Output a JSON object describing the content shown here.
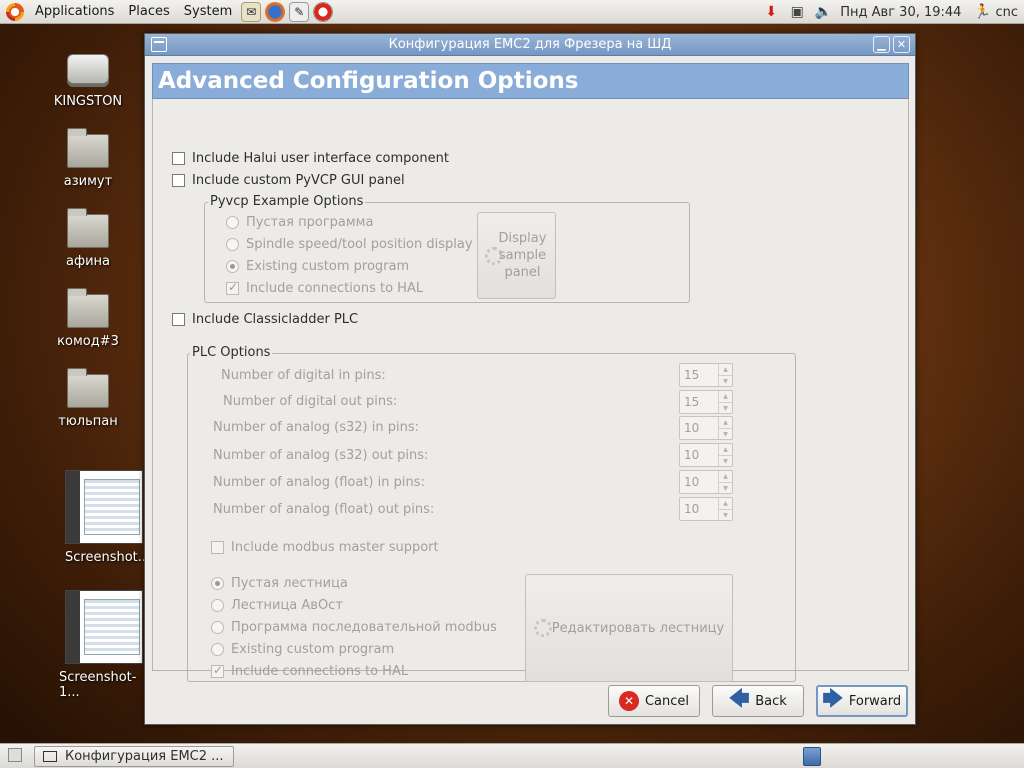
{
  "top_panel": {
    "menus": [
      "Applications",
      "Places",
      "System"
    ],
    "clock": "Пнд Авг 30, 19:44",
    "user": "cnc"
  },
  "desktop": {
    "icons": [
      "KINGSTON",
      "азимут",
      "афина",
      "комод#3",
      "тюльпан",
      "Screenshot...",
      "Screenshot-1..."
    ]
  },
  "window": {
    "title": "Конфигурация EMC2 для Фрезера на ШД",
    "heading": "Advanced Configuration Options",
    "options": {
      "halui": "Include Halui user interface component",
      "pyvcp": "Include custom PyVCP GUI panel",
      "classicladder": "Include Classicladder PLC"
    },
    "pyvcp_frame": {
      "title": "Pyvcp Example Options",
      "radios": [
        "Пустая программа",
        "Spindle speed/tool position display",
        "Existing custom program"
      ],
      "include_hal": "Include connections to HAL",
      "display_button": "Display sample panel"
    },
    "plc_frame": {
      "title": "PLC Options",
      "pins": [
        {
          "label": "Number of digital in pins:",
          "value": "15"
        },
        {
          "label": "Number of digital  out pins:",
          "value": "15"
        },
        {
          "label": "Number of analog (s32) in pins:",
          "value": "10"
        },
        {
          "label": "Number of analog (s32) out pins:",
          "value": "10"
        },
        {
          "label": "Number of analog (float) in pins:",
          "value": "10"
        },
        {
          "label": "Number of analog (float) out pins:",
          "value": "10"
        }
      ],
      "modbus": "Include modbus master support",
      "radios": [
        "Пустая лестница",
        "Лестница АвОст",
        "Программа последовательной modbus",
        "Existing custom program"
      ],
      "include_hal": "Include connections to HAL",
      "edit_button": "Редактировать лестницу"
    },
    "buttons": {
      "cancel": "Cancel",
      "back": "Back",
      "forward": "Forward"
    }
  },
  "bottom_panel": {
    "task": "Конфигурация EMC2 ..."
  },
  "colors": {
    "header_band": "#8aacd8",
    "titlebar": "#7597c3",
    "disabled_text": "#a3a09a"
  }
}
